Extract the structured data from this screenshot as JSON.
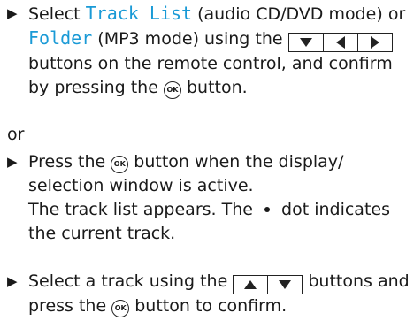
{
  "step1": {
    "bullet": "▶",
    "pre": "Select ",
    "option1": "Track List",
    "mid1": " (audio CD/DVD mode) or ",
    "option2": "Folder",
    "mid2": " (MP3 mode) using the ",
    "keys": [
      "down-arrow-icon",
      "left-arrow-icon",
      "right-arrow-icon"
    ],
    "post": " buttons on the remote control, and confirm by pressing the ",
    "end": " button."
  },
  "or_text": "or",
  "step2": {
    "bullet": "▶",
    "pre": "Press the ",
    "post": " button when the display/ selection window is active.",
    "result_pre": "The track list appears. The ",
    "result_post": " dot indicates the current track."
  },
  "step3": {
    "bullet": "▶",
    "pre": "Select a track using the ",
    "keys": [
      "up-arrow-icon",
      "down-arrow-icon"
    ],
    "mid": " buttons and press the ",
    "post": " button to confirm."
  },
  "ok_label": "OK",
  "colors": {
    "highlight": "#1a9ad6",
    "text": "#1a1a1a"
  }
}
